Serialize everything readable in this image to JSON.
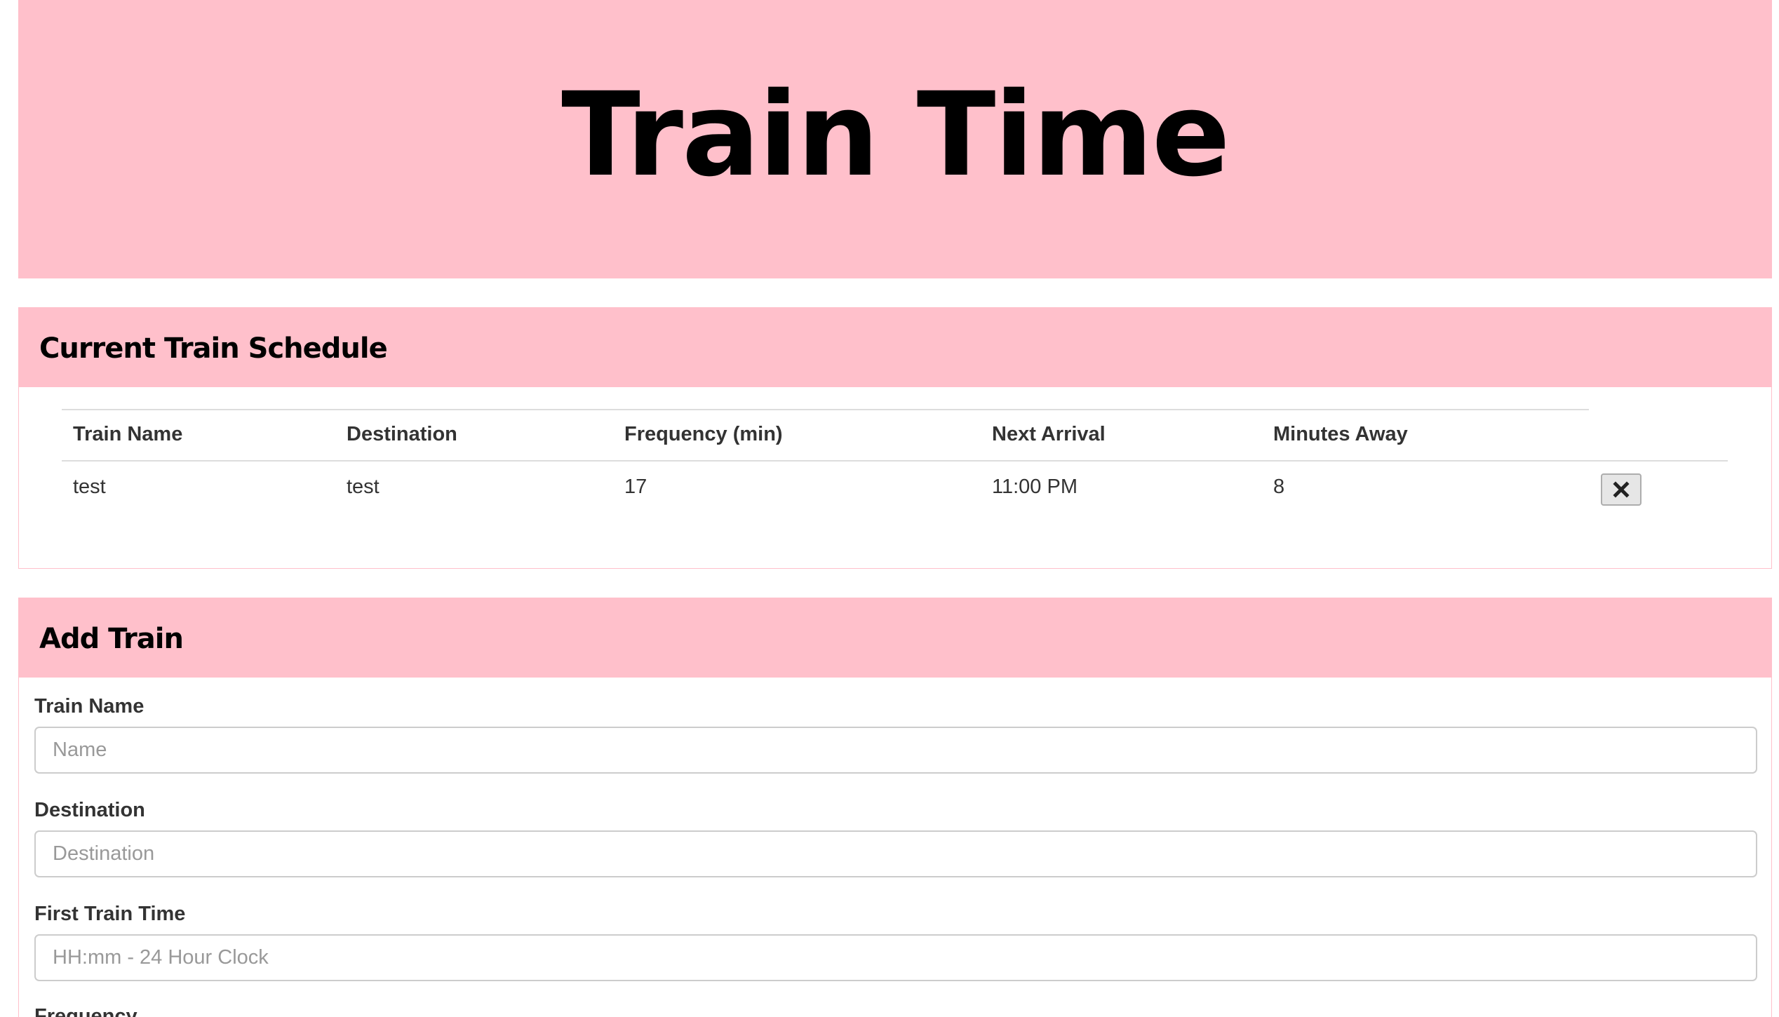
{
  "header": {
    "title": "Train Time"
  },
  "schedule": {
    "title": "Current Train Schedule",
    "columns": [
      "Train Name",
      "Destination",
      "Frequency (min)",
      "Next Arrival",
      "Minutes Away"
    ],
    "rows": [
      {
        "train_name": "test",
        "destination": "test",
        "frequency": "17",
        "next_arrival": "11:00 PM",
        "minutes_away": "8",
        "delete_icon": "close-x-icon"
      }
    ]
  },
  "add_train": {
    "title": "Add Train",
    "fields": [
      {
        "label": "Train Name",
        "placeholder": "Name",
        "value": ""
      },
      {
        "label": "Destination",
        "placeholder": "Destination",
        "value": ""
      },
      {
        "label": "First Train Time",
        "placeholder": "HH:mm - 24 Hour Clock",
        "value": ""
      },
      {
        "label": "Frequency",
        "placeholder": "",
        "value": ""
      }
    ]
  },
  "colors": {
    "accent": "#ffc0cb",
    "text": "#333333",
    "heading": "#000000"
  }
}
